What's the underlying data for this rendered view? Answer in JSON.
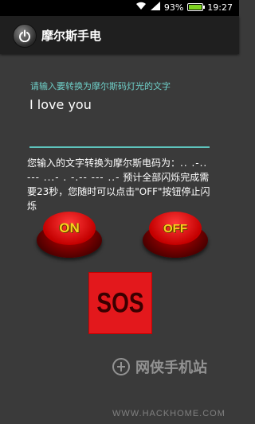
{
  "status_bar": {
    "battery": "93%",
    "time": "19:27"
  },
  "app": {
    "title": "摩尔斯手电"
  },
  "input": {
    "prompt": "请输入要转换为摩尔斯码灯光的文字",
    "value": "I love you"
  },
  "result": {
    "prefix": "您输入的文字转换为摩尔斯电码为：",
    "morse": ".. .-.. --- ...- . -.-- --- ..-",
    "suffix": "预计全部闪烁完成需要23秒，您随时可以点击\"OFF\"按钮停止闪烁"
  },
  "buttons": {
    "on": "ON",
    "off": "OFF",
    "sos": "SOS"
  },
  "watermark": {
    "name": "网侠手机站",
    "url": "WWW.HACKHOME.COM"
  },
  "colors": {
    "accent": "#5ec4bd",
    "button_red": "#e3181c",
    "button_text": "#f7d21c"
  }
}
